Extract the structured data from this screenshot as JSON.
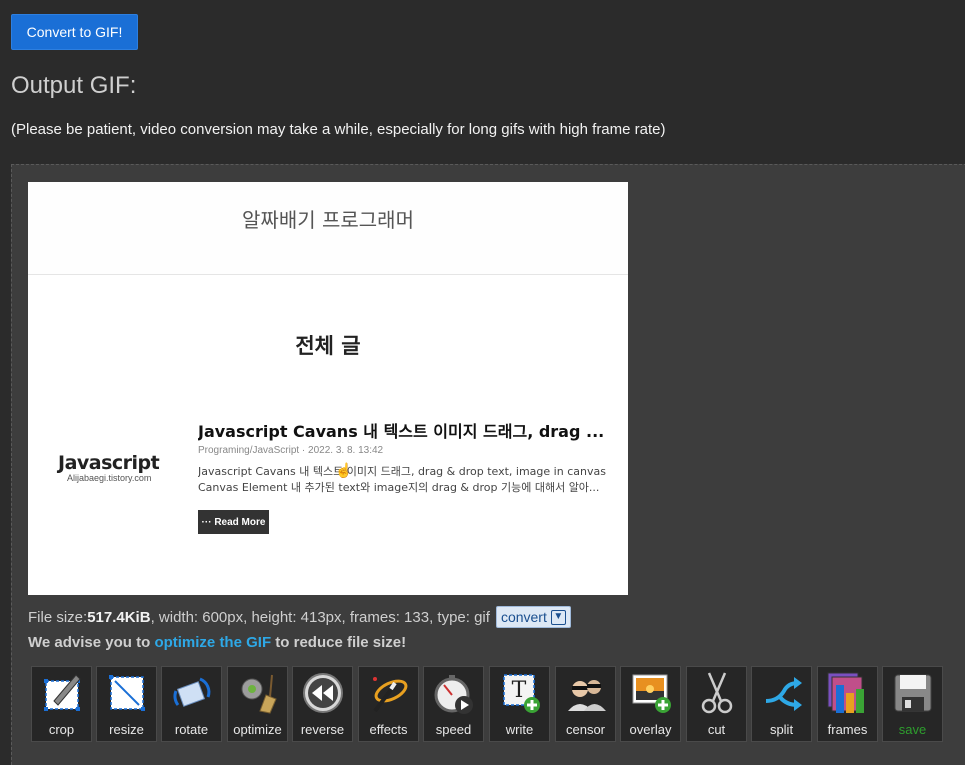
{
  "convert_button": "Convert to GIF!",
  "output_heading": "Output GIF:",
  "patience_note": "(Please be patient, video conversion may take a while, especially for long gifs with high frame rate)",
  "preview": {
    "blog_title": "알짜배기 프로그래머",
    "page_heading": "전체 글",
    "thumb_title": "Javascript",
    "thumb_sub": "Alijabaegi.tistory.com",
    "post_title": "Javascript Cavans 내 텍스트 이미지 드래그, drag ...",
    "post_meta": "Programing/JavaScript · 2022. 3. 8. 13:42",
    "excerpt_line1": "Javascript Cavans 내 텍스트 이미지 드래그, drag & drop text, image in canvas",
    "excerpt_line2": "Canvas Element 내 추가된 text와 image지의 drag & drop 기능에 대해서 알아...",
    "read_more": "··· Read More"
  },
  "file_info": {
    "prefix": "File size: ",
    "size": "517.4KiB",
    "rest": ", width: 600px, height: 413px, frames: 133, type: gif",
    "convert": "convert"
  },
  "advise": {
    "before": "We advise you to ",
    "link": "optimize the GIF",
    "after": " to reduce file size!"
  },
  "tools": [
    {
      "label": "crop",
      "icon": "crop-icon"
    },
    {
      "label": "resize",
      "icon": "resize-icon"
    },
    {
      "label": "rotate",
      "icon": "rotate-icon"
    },
    {
      "label": "optimize",
      "icon": "optimize-broom-icon"
    },
    {
      "label": "reverse",
      "icon": "reverse-icon"
    },
    {
      "label": "effects",
      "icon": "effects-wand-icon"
    },
    {
      "label": "speed",
      "icon": "speed-stopwatch-icon"
    },
    {
      "label": "write",
      "icon": "write-text-icon"
    },
    {
      "label": "censor",
      "icon": "censor-icon"
    },
    {
      "label": "overlay",
      "icon": "overlay-image-icon"
    },
    {
      "label": "cut",
      "icon": "cut-scissors-icon"
    },
    {
      "label": "split",
      "icon": "split-arrows-icon"
    },
    {
      "label": "frames",
      "icon": "frames-icon"
    },
    {
      "label": "save",
      "icon": "save-floppy-icon"
    }
  ],
  "colors": {
    "background": "#2b2b2b",
    "button_blue": "#1a6fd6",
    "link_blue": "#2ea8e6",
    "save_green": "#2e9e2e"
  }
}
